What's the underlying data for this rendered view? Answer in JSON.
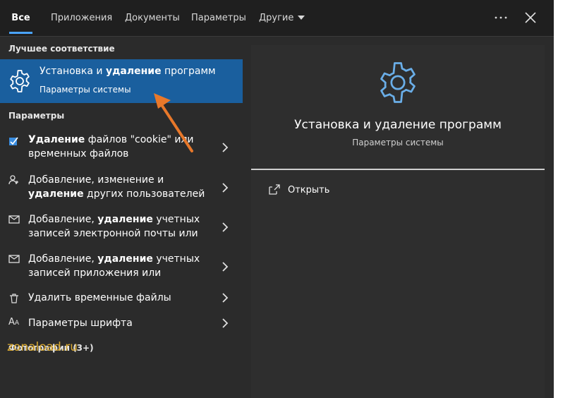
{
  "tabs": [
    {
      "label": "Все",
      "active": true
    },
    {
      "label": "Приложения"
    },
    {
      "label": "Документы"
    },
    {
      "label": "Параметры"
    },
    {
      "label": "Другие"
    }
  ],
  "sections": {
    "best_match": "Лучшее соответствие",
    "settings": "Параметры",
    "photos": "Фотографии (3+)"
  },
  "best_match": {
    "title_pre": "Установка и ",
    "title_bold": "удаление",
    "title_post": " программ",
    "subtitle": "Параметры системы",
    "icon": "gear-icon"
  },
  "items": [
    {
      "icon": "cleanup-icon",
      "line1_bold": "Удаление",
      "line1_rest": " файлов \"cookie\" или",
      "line2_pre": "временных файлов",
      "line2_bold": "",
      "line2_post": ""
    },
    {
      "icon": "person-icon",
      "line1_bold": "",
      "line1_rest": "Добавление, изменение и",
      "line2_pre": "",
      "line2_bold": "удаление",
      "line2_post": " других пользователей"
    },
    {
      "icon": "mail-icon",
      "line1_bold": "",
      "line1_rest": "Добавление, ",
      "line1_bold2": "удаление",
      "line1_rest2": " учетных",
      "line2_pre": "записей электронной почты или",
      "line2_bold": "",
      "line2_post": ""
    },
    {
      "icon": "mail-icon",
      "line1_bold": "",
      "line1_rest": "Добавление, ",
      "line1_bold2": "удаление",
      "line1_rest2": " учетных",
      "line2_pre": "записей приложения или",
      "line2_bold": "",
      "line2_post": ""
    },
    {
      "icon": "trash-icon",
      "single": "Удалить временные файлы"
    },
    {
      "icon": "font-icon",
      "single": "Параметры шрифта",
      "icon_glyph": "A"
    }
  ],
  "preview": {
    "title": "Установка и удаление программ",
    "subtitle": "Параметры системы",
    "open_label": "Открыть"
  },
  "watermark": "zonaload.ru",
  "colors": {
    "accent": "#1a5f9e",
    "tab_underline": "#4aa3ff",
    "arrow": "#e8782a",
    "gear": "#6aaee8",
    "watermark": "#d8a830"
  }
}
